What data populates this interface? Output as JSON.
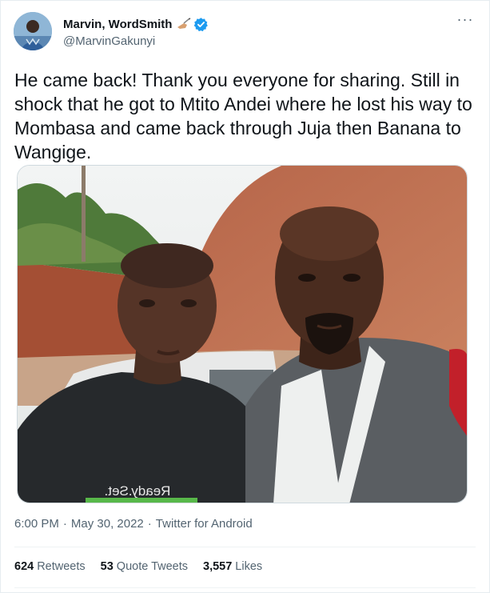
{
  "author": {
    "display_name": "Marvin, WordSmith",
    "handle": "@MarvinGakunyi",
    "name_emoji": "writing-hand-emoji",
    "verified": true
  },
  "more_icon": "more-dots-icon",
  "tweet": {
    "text": "He came back! Thank you everyone for sharing. Still in shock that he got to Mtito Andei where he lost his way to Mombasa and came back through Juja then Banana to Wangige.",
    "shirt_text": "Ready.Set."
  },
  "meta": {
    "time": "6:00 PM",
    "separator": "·",
    "date": "May 30, 2022",
    "source": "Twitter for Android"
  },
  "stats": [
    {
      "count": "624",
      "label": "Retweets"
    },
    {
      "count": "53",
      "label": "Quote Tweets"
    },
    {
      "count": "3,557",
      "label": "Likes"
    }
  ],
  "colors": {
    "accent": "#1d9bf0",
    "text_primary": "#0f1419",
    "text_secondary": "#536471",
    "border": "#cfd9de"
  }
}
